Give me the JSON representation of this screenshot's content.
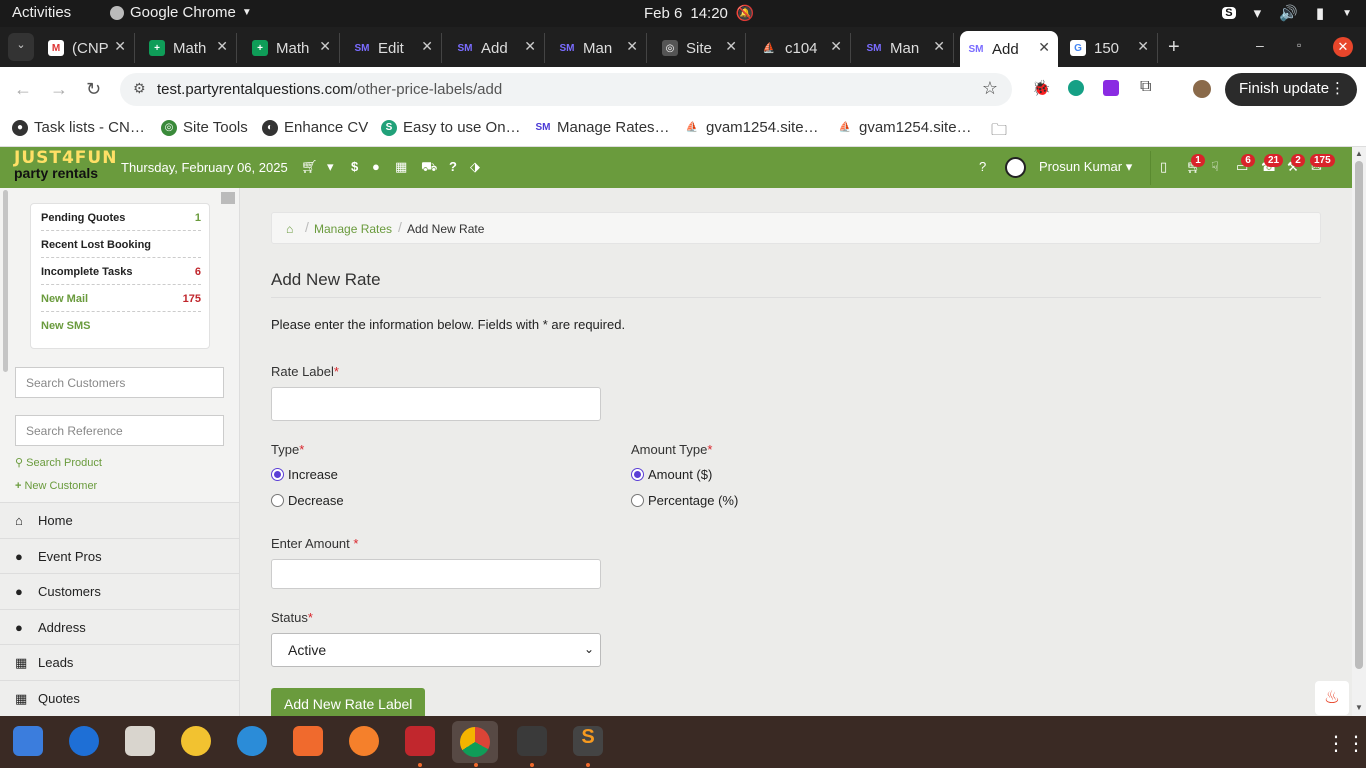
{
  "topbar": {
    "activities": "Activities",
    "app": "Google Chrome",
    "date": "Feb 6",
    "time": "14:20"
  },
  "tabs": [
    {
      "label": "(CNP",
      "icon": "gmail-icon"
    },
    {
      "label": "Math",
      "icon": "sheets-icon"
    },
    {
      "label": "Math",
      "icon": "sheets-icon"
    },
    {
      "label": "Edit",
      "icon": "sm-icon"
    },
    {
      "label": "Add",
      "icon": "sm-icon"
    },
    {
      "label": "Man",
      "icon": "sm-icon"
    },
    {
      "label": "Site",
      "icon": "site-icon"
    },
    {
      "label": "c104",
      "icon": "pma-icon"
    },
    {
      "label": "Man",
      "icon": "sm-icon"
    },
    {
      "label": "Add",
      "icon": "sm-icon"
    },
    {
      "label": "150",
      "icon": "google-icon"
    }
  ],
  "address": {
    "host": "test.partyrentalquestions.com",
    "path": "/other-price-labels/add"
  },
  "finish_update": "Finish update",
  "bookmarks": [
    {
      "label": "Task lists - CN…"
    },
    {
      "label": "Site Tools"
    },
    {
      "label": "Enhance CV"
    },
    {
      "label": "Easy to use On…"
    },
    {
      "label": "Manage Rates…"
    },
    {
      "label": "gvam1254.site…"
    },
    {
      "label": "gvam1254.site…"
    }
  ],
  "header": {
    "logo_line1": "JUST4FUN",
    "logo_line2": "party rentals",
    "date": "Thursday, February 06, 2025",
    "user": "Prosun Kumar",
    "badges": [
      "1",
      "6",
      "21",
      "2",
      "175"
    ]
  },
  "sidebar": {
    "summary": [
      {
        "label": "Pending Quotes",
        "count": "1"
      },
      {
        "label": "Recent Lost Booking",
        "count": ""
      },
      {
        "label": "Incomplete Tasks",
        "count": "6"
      },
      {
        "label": "New Mail",
        "count": "175"
      },
      {
        "label": "New SMS",
        "count": ""
      }
    ],
    "search_customers": "Search Customers",
    "search_reference": "Search Reference",
    "search_product": "Search Product",
    "new_customer": "New Customer",
    "nav": [
      "Home",
      "Event Pros",
      "Customers",
      "Address",
      "Leads",
      "Quotes"
    ]
  },
  "breadcrumb": {
    "parent": "Manage Rates",
    "current": "Add New Rate"
  },
  "form": {
    "title": "Add New Rate",
    "intro": "Please enter the information below. Fields with * are required.",
    "rate_label": "Rate Label",
    "type_label": "Type",
    "type_options": [
      "Increase",
      "Decrease"
    ],
    "type_selected": "Increase",
    "amount_type_label": "Amount Type",
    "amount_type_options": [
      "Amount ($)",
      "Percentage (%)"
    ],
    "amount_type_selected": "Amount ($)",
    "amount_label": "Enter Amount",
    "status_label": "Status",
    "status_value": "Active",
    "submit": "Add New Rate Label",
    "required_mark": "*"
  }
}
